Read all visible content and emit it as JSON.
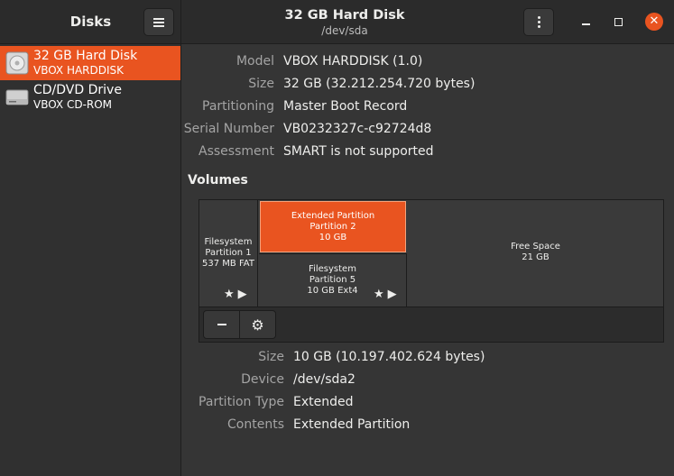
{
  "app": {
    "title": "Disks"
  },
  "header": {
    "title": "32 GB Hard Disk",
    "subtitle": "/dev/sda"
  },
  "sidebar": {
    "drives": [
      {
        "name": "32 GB Hard Disk",
        "model": "VBOX HARDDISK",
        "icon": "hard-disk-icon",
        "selected": true
      },
      {
        "name": "CD/DVD Drive",
        "model": "VBOX CD-ROM",
        "icon": "optical-drive-icon",
        "selected": false
      }
    ]
  },
  "disk_info": [
    {
      "label": "Model",
      "value": "VBOX HARDDISK (1.0)"
    },
    {
      "label": "Size",
      "value": "32 GB (32.212.254.720 bytes)"
    },
    {
      "label": "Partitioning",
      "value": "Master Boot Record"
    },
    {
      "label": "Serial Number",
      "value": "VB0232327c-c92724d8"
    },
    {
      "label": "Assessment",
      "value": "SMART is not supported"
    }
  ],
  "volumes": {
    "title": "Volumes",
    "partition1": {
      "line1": "Filesystem",
      "line2": "Partition 1",
      "line3": "537 MB FAT"
    },
    "extended": {
      "line1": "Extended Partition",
      "line2": "Partition 2",
      "line3": "10 GB"
    },
    "partition5": {
      "line1": "Filesystem",
      "line2": "Partition 5",
      "line3": "10 GB Ext4"
    },
    "free": {
      "line1": "Free Space",
      "line2": "21 GB"
    },
    "glyphs": "★▶"
  },
  "selected_volume": [
    {
      "label": "Size",
      "value": "10 GB (10.197.402.624 bytes)"
    },
    {
      "label": "Device",
      "value": "/dev/sda2"
    },
    {
      "label": "Partition Type",
      "value": "Extended"
    },
    {
      "label": "Contents",
      "value": "Extended Partition"
    }
  ],
  "colors": {
    "accent": "#e95420",
    "background": "#353535",
    "sidebar": "#303030",
    "label": "#a4a4a4"
  }
}
